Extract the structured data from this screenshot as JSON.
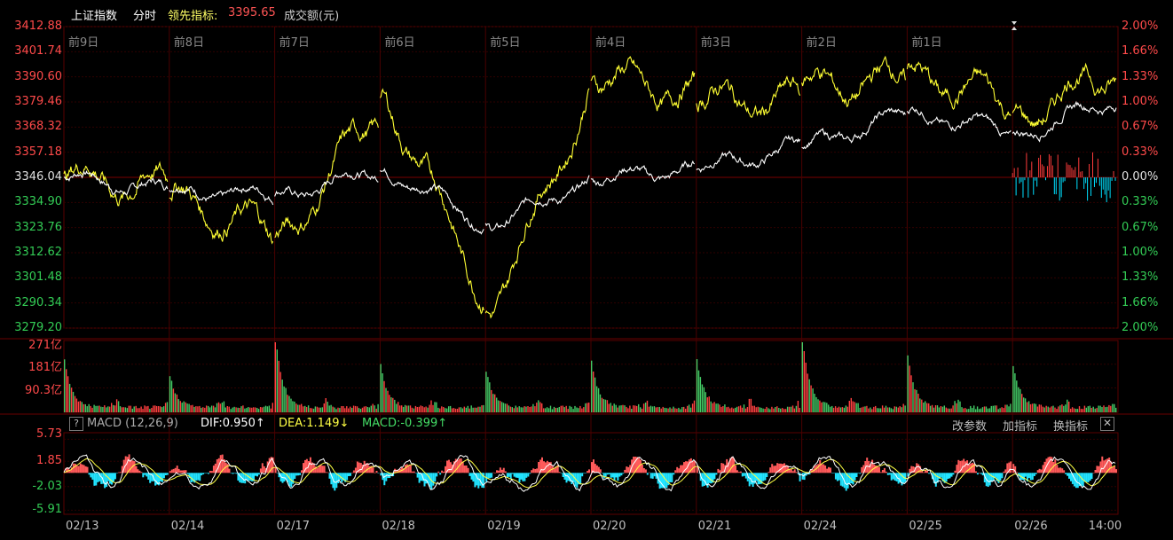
{
  "header": {
    "index_name": "上证指数",
    "mode": "分时",
    "lead_label": "领先指标:",
    "lead_value": "3395.65",
    "volume_label": "成交额(元)"
  },
  "price_axis": {
    "left_labels": [
      "3412.88",
      "3401.74",
      "3390.60",
      "3379.46",
      "3368.32",
      "3357.18",
      "3346.04",
      "3334.90",
      "3323.76",
      "3312.62",
      "3301.48",
      "3290.34",
      "3279.20"
    ],
    "right_labels": [
      "2.00%",
      "1.66%",
      "1.33%",
      "1.00%",
      "0.67%",
      "0.33%",
      "0.00%",
      "0.33%",
      "0.67%",
      "1.00%",
      "1.33%",
      "1.66%",
      "2.00%"
    ]
  },
  "day_labels": [
    "前9日",
    "前8日",
    "前7日",
    "前6日",
    "前5日",
    "前4日",
    "前3日",
    "前2日",
    "前1日"
  ],
  "volume_axis": {
    "labels": [
      "271亿",
      "181亿",
      "90.3亿"
    ]
  },
  "macd": {
    "title": "MACD (12,26,9)",
    "dif": "DIF:0.950↑",
    "dea": "DEA:1.149↓",
    "macd": "MACD:-0.399↑",
    "btn_params": "改参数",
    "btn_add": "加指标",
    "btn_switch": "换指标",
    "help_glyph": "?",
    "close_glyph": "✕",
    "axis_labels": [
      "5.73",
      "1.85",
      "-2.03",
      "-5.91"
    ]
  },
  "x_axis": {
    "labels": [
      "02/13",
      "02/14",
      "02/17",
      "02/18",
      "02/19",
      "02/20",
      "02/21",
      "02/24",
      "02/25",
      "02/26",
      "14:00"
    ]
  },
  "colors": {
    "up": "#ff3b3b",
    "down": "#00e0ff",
    "neutral": "#e8e8e8",
    "price_line": "#ffffff",
    "lead_line": "#ffff33",
    "grid": "#3a0000",
    "vol_up": "#ff4040",
    "vol_down": "#44cc66",
    "macd_label_green": "#44dd66"
  },
  "chart_data": {
    "type": "line",
    "series": [
      {
        "name": "上证指数",
        "description": "price"
      },
      {
        "name": "领先指标",
        "description": "leading indicator"
      }
    ],
    "ylim": [
      3279.2,
      3412.88
    ],
    "prev_close": 3346.04,
    "x": [
      "02/13",
      "02/14",
      "02/17",
      "02/18",
      "02/19",
      "02/20",
      "02/21",
      "02/24",
      "02/25",
      "02/26"
    ],
    "price_day_end": [
      3340,
      3338,
      3350,
      3325,
      3346,
      3350,
      3360,
      3375,
      3366,
      3382
    ],
    "lead_day_end": [
      3342,
      3320,
      3380,
      3290,
      3390,
      3382,
      3380,
      3390,
      3378,
      3395.65
    ],
    "volume_peaks": [
      180,
      120,
      271,
      160,
      140,
      170,
      180,
      271,
      190,
      160
    ]
  }
}
